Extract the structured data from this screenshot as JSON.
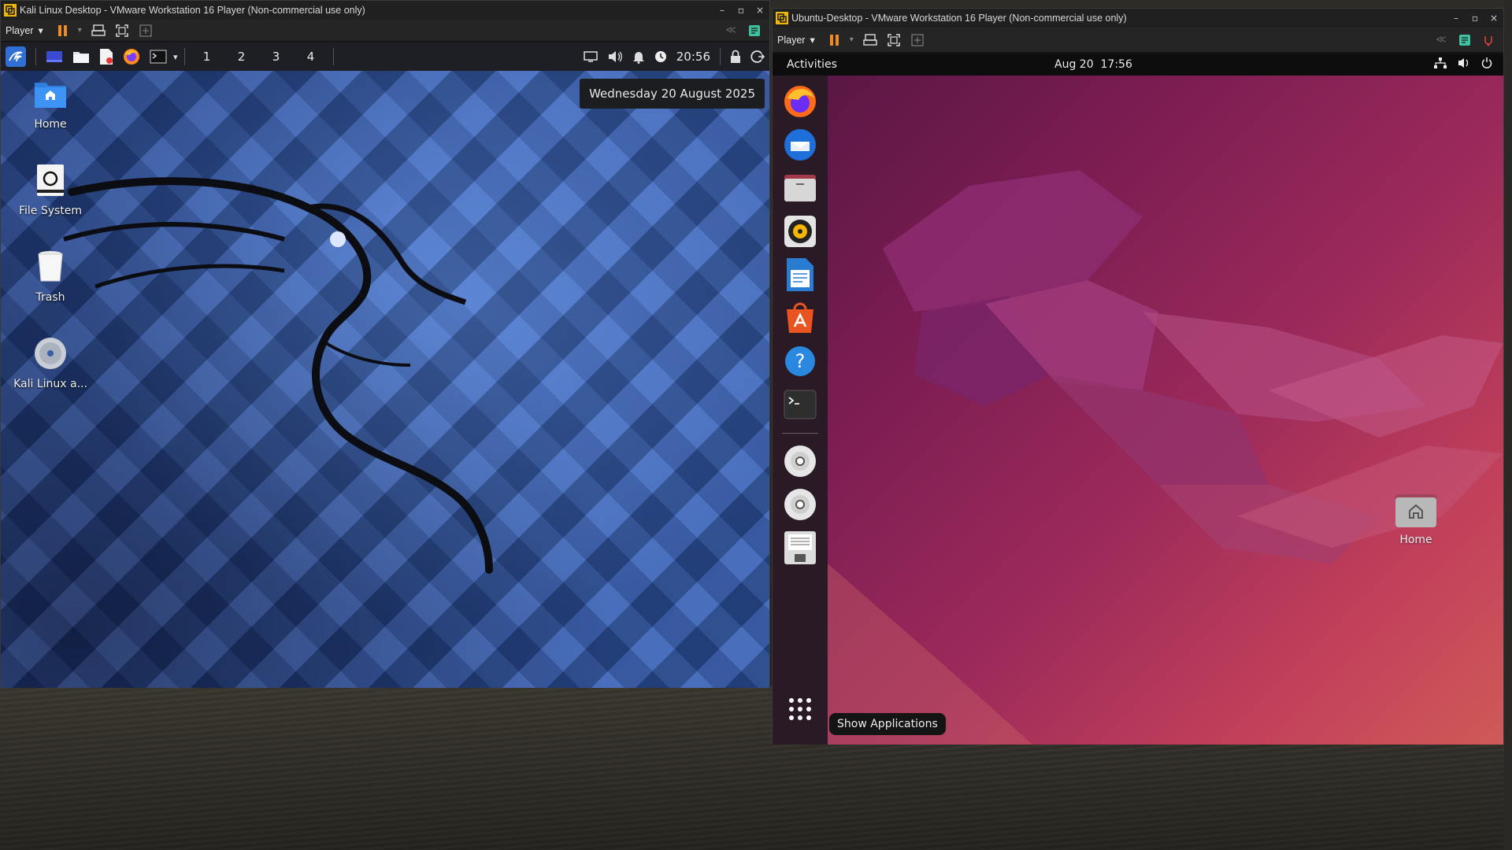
{
  "host": {
    "colors": {
      "host_bg": "#2a2823"
    }
  },
  "kali_vm": {
    "window_title": "Kali Linux Desktop - VMware Workstation 16 Player (Non-commercial use only)",
    "player_label": "Player",
    "window_controls": [
      "–",
      "▫",
      "×"
    ],
    "panel": {
      "workspaces": [
        "1",
        "2",
        "3",
        "4"
      ],
      "clock": "20:56"
    },
    "date_tooltip": "Wednesday 20 August 2025",
    "desktop_icons": [
      {
        "label": "Home",
        "icon": "home-folder-icon"
      },
      {
        "label": "File System",
        "icon": "drive-icon"
      },
      {
        "label": "Trash",
        "icon": "trash-icon"
      },
      {
        "label": "Kali Linux a...",
        "icon": "optical-disc-icon"
      }
    ],
    "colors": {
      "accent": "#f08a24",
      "panel": "#1d1f24",
      "wall": "#2b4c94"
    }
  },
  "ubuntu_vm": {
    "window_title": "Ubuntu-Desktop - VMware Workstation 16 Player (Non-commercial use only)",
    "player_label": "Player",
    "window_controls": [
      "–",
      "▫",
      "×"
    ],
    "topbar": {
      "activities": "Activities",
      "datetime": "Aug 20  17:56"
    },
    "dock_items": [
      {
        "name": "firefox",
        "icon": "firefox-icon"
      },
      {
        "name": "thunderbird",
        "icon": "thunderbird-icon"
      },
      {
        "name": "files",
        "icon": "files-icon"
      },
      {
        "name": "rhythmbox",
        "icon": "rhythmbox-icon"
      },
      {
        "name": "libreoffice-writer",
        "icon": "writer-icon"
      },
      {
        "name": "app-center",
        "icon": "app-store-icon"
      },
      {
        "name": "help",
        "icon": "help-icon"
      },
      {
        "name": "terminal",
        "icon": "terminal-icon"
      },
      {
        "name": "disc-1",
        "icon": "disc-icon"
      },
      {
        "name": "disc-2",
        "icon": "disc-icon"
      },
      {
        "name": "floppy",
        "icon": "floppy-icon"
      }
    ],
    "show_apps_tooltip": "Show Applications",
    "desktop_icons": [
      {
        "label": "Home",
        "icon": "home-folder-icon"
      }
    ],
    "colors": {
      "accent": "#e95420",
      "wall_start": "#5a1745",
      "wall_end": "#cf5a58"
    }
  }
}
